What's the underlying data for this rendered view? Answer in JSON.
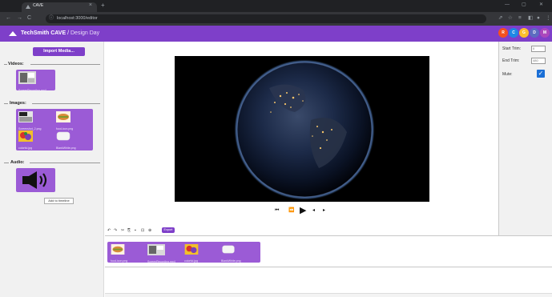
{
  "browser": {
    "tab_title": "CAVE",
    "url": "localhost:3000/editor",
    "new_tab": "+",
    "close_tab": "×"
  },
  "app": {
    "brand": "TechSmith CAVE",
    "separator": "/",
    "project": "Design Day",
    "accent_color": "#7e3fc9",
    "avatars": [
      {
        "initial": "R",
        "color": "#f4511e"
      },
      {
        "initial": "C",
        "color": "#1e88e5"
      },
      {
        "initial": "G",
        "color": "#fbc02d"
      },
      {
        "initial": "D",
        "color": "#5c6bc0"
      },
      {
        "initial": "M",
        "color": "#ab47bc"
      }
    ]
  },
  "left_panel": {
    "import_button": "Import Media...",
    "videos_label": "Videos:",
    "images_label": "Images:",
    "audio_label": "Audio:",
    "video_items": [
      {
        "caption": "ScreenRecording.mp4"
      }
    ],
    "image_items": [
      {
        "caption": "Screenshot_2.png"
      },
      {
        "caption": "food-icon.png"
      },
      {
        "caption": "colorful.jpg"
      },
      {
        "caption": "BlankWhite.png"
      }
    ],
    "add_to_timeline": "Add to timeline"
  },
  "preview": {
    "controls": [
      "⏮",
      "⏪",
      "▶",
      "◂",
      "▸"
    ]
  },
  "toolbar_tools": [
    "↶",
    "↷",
    "✂",
    "⎘",
    "▪",
    "⊡",
    "⊕"
  ],
  "export_label": "Export",
  "right_panel": {
    "start_trim_label": "Start Trim:",
    "start_trim_value": "0",
    "end_trim_label": "End Trim:",
    "end_trim_value": "480",
    "mute_label": "Mute:",
    "mute_checked": true
  },
  "timeline": {
    "items": [
      {
        "caption": "food-icon.png"
      },
      {
        "caption": "ScreenRecording.mp4"
      },
      {
        "caption": "colorful.jpg"
      },
      {
        "caption": "BlankWhite.png"
      }
    ]
  }
}
